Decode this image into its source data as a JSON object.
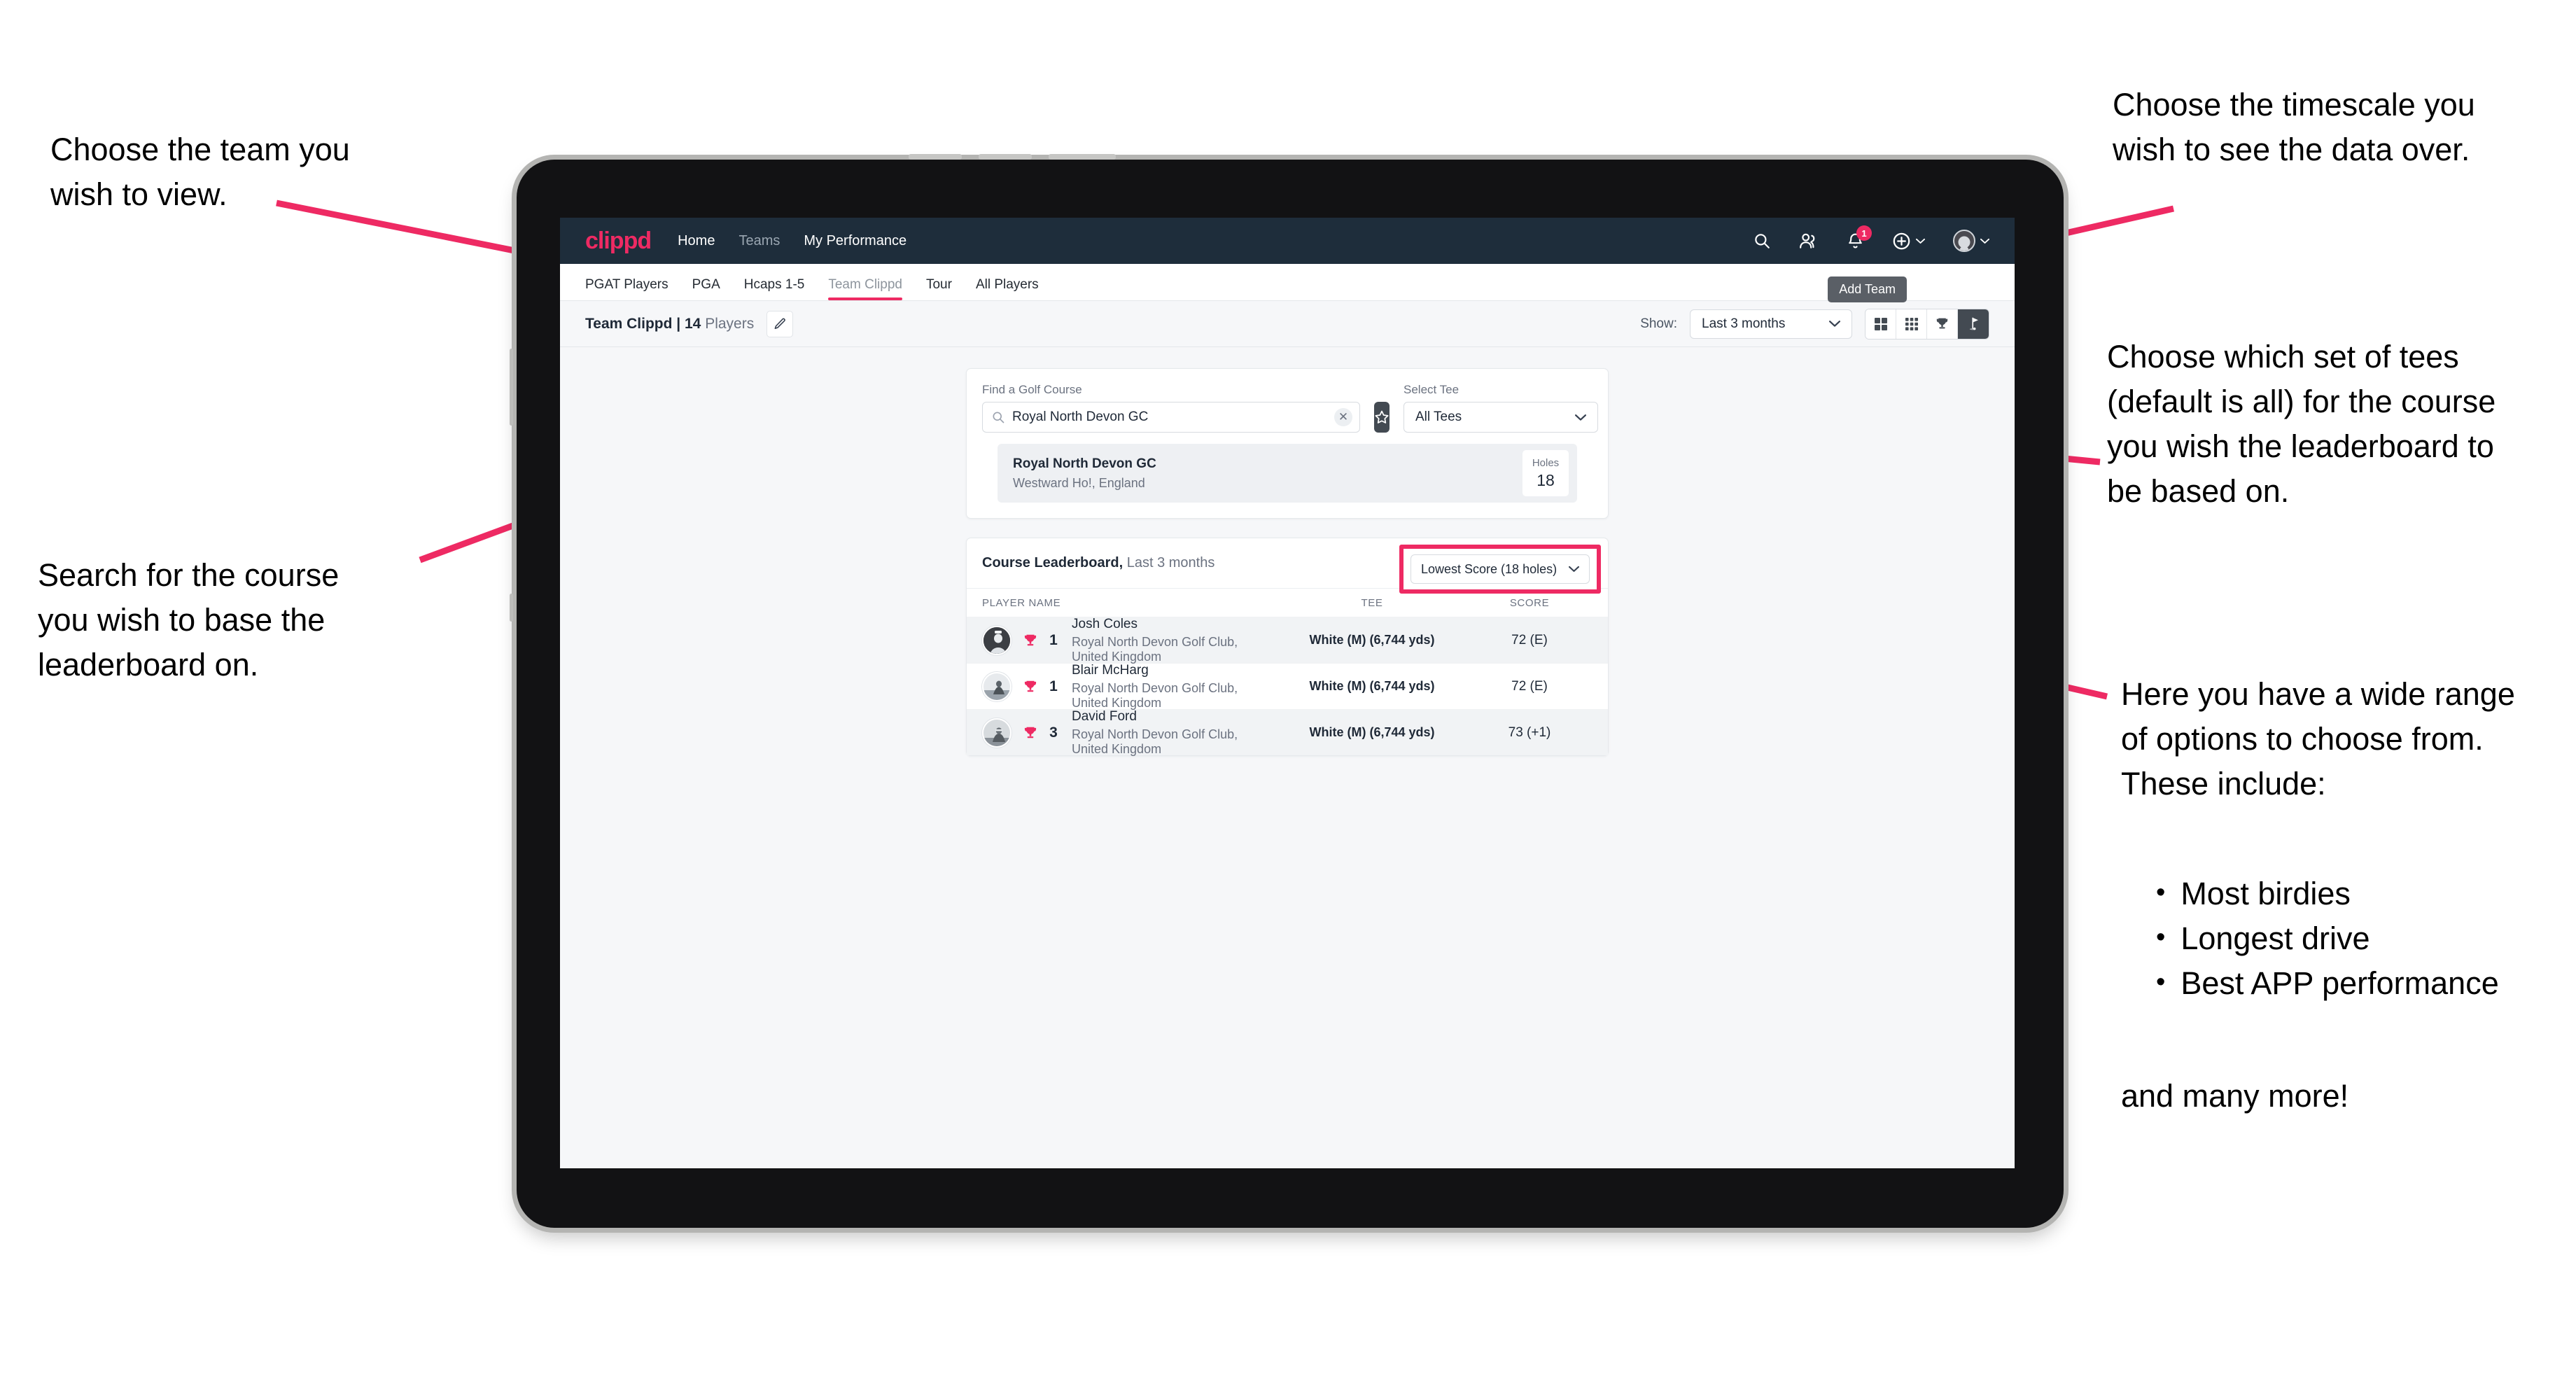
{
  "annotations": {
    "top_left": "Choose the team you\nwish to view.",
    "mid_left": "Search for the course\nyou wish to base the\nleaderboard on.",
    "top_right": "Choose the timescale you\nwish to see the data over.",
    "mid_right": "Choose which set of tees\n(default is all) for the course\nyou wish the leaderboard to\nbe based on.",
    "bottom_right": "Here you have a wide range\nof options to choose from.\nThese include:",
    "bullets": [
      "Most birdies",
      "Longest drive",
      "Best APP performance"
    ],
    "footer": "and many more!"
  },
  "topnav": {
    "brand": "clippd",
    "links": [
      {
        "label": "Home",
        "dim": false
      },
      {
        "label": "Teams",
        "dim": true
      },
      {
        "label": "My Performance",
        "dim": false
      }
    ],
    "icons": [
      "search-icon",
      "people-icon",
      "bell-icon",
      "plus-circle-icon",
      "avatar-icon"
    ],
    "notification_count": "1"
  },
  "tabs": {
    "items": [
      {
        "label": "PGAT Players",
        "active": false
      },
      {
        "label": "PGA",
        "active": false
      },
      {
        "label": "Hcaps 1-5",
        "active": false
      },
      {
        "label": "Team Clippd",
        "active": true
      },
      {
        "label": "Tour",
        "active": false
      },
      {
        "label": "All Players",
        "active": false
      }
    ],
    "tooltip": "Add Team"
  },
  "subheader": {
    "team_name": "Team Clippd",
    "separator": " | ",
    "player_count": "14",
    "players_word": " Players",
    "edit_icon": "pencil-icon",
    "show_label": "Show:",
    "timescale_value": "Last 3 months",
    "view_toggles": [
      {
        "icon": "grid-4-icon",
        "active": false
      },
      {
        "icon": "grid-9-icon",
        "active": false
      },
      {
        "icon": "trophy-icon",
        "active": false
      },
      {
        "icon": "golf-flag-icon",
        "active": true
      }
    ]
  },
  "search": {
    "course_label": "Find a Golf Course",
    "course_value": "Royal North Devon GC",
    "course_placeholder": "Find a Golf Course",
    "clear_icon": "close-icon",
    "favourite_icon": "star-icon",
    "tee_label": "Select Tee",
    "tee_value": "All Tees"
  },
  "course_result": {
    "name": "Royal North Devon GC",
    "location": "Westward Ho!, England",
    "holes_label": "Holes",
    "holes_value": "18"
  },
  "leaderboard": {
    "title": "Course Leaderboard,",
    "subtitle": " Last 3 months",
    "sort_value": "Lowest Score (18 holes)",
    "columns": {
      "player": "PLAYER NAME",
      "tee": "TEE",
      "score": "SCORE"
    },
    "rows": [
      {
        "rank": "1",
        "name": "Josh Coles",
        "club": "Royal North Devon Golf Club, United Kingdom",
        "tee": "White (M) (6,744 yds)",
        "score": "72 (E)"
      },
      {
        "rank": "1",
        "name": "Blair McHarg",
        "club": "Royal North Devon Golf Club, United Kingdom",
        "tee": "White (M) (6,744 yds)",
        "score": "72 (E)"
      },
      {
        "rank": "3",
        "name": "David Ford",
        "club": "Royal North Devon Golf Club, United Kingdom",
        "tee": "White (M) (6,744 yds)",
        "score": "73 (+1)"
      }
    ]
  },
  "colors": {
    "accent": "#ee2a63",
    "navbar": "#1e2d3b",
    "dark_button": "#434a52",
    "page_bg": "#f6f7f9"
  }
}
